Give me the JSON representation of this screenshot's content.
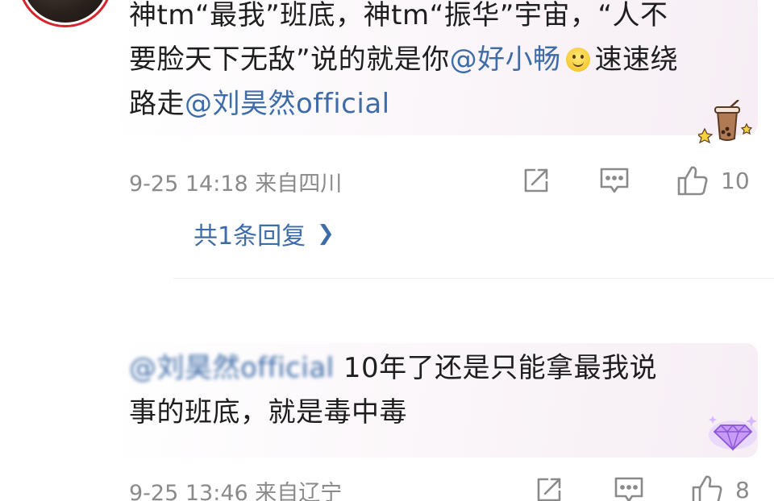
{
  "comment1": {
    "lines": [
      "神tm“最我”班底，神tm“振华”宇宙，“人不",
      "要脸天下无敌”说的就是你"
    ],
    "mention1": "@好小畅",
    "after_emoji": "速速绕",
    "line3_prefix": "路走",
    "mention2": "@刘昊然official",
    "time": "9-25 14:18",
    "location": "来自四川",
    "likes": "10",
    "replies": "共1条回复"
  },
  "comment2": {
    "mention_blurred": "@刘昊然official",
    "line1_rest": " 10年了还是只能拿最我说",
    "line2": "事的班底，就是毒中毒",
    "time": "9-25 13:46",
    "location": "来自辽宁",
    "likes": "8"
  },
  "icons": {
    "share": "share-icon",
    "comment": "comment-icon",
    "like": "thumbs-up-icon",
    "emoji": "smile-emoji-icon",
    "chevron": "chevron-right-icon"
  },
  "colors": {
    "mention": "#3d6ca8",
    "meta": "#8a8a8a",
    "avatar_ring": "#d9232f"
  }
}
